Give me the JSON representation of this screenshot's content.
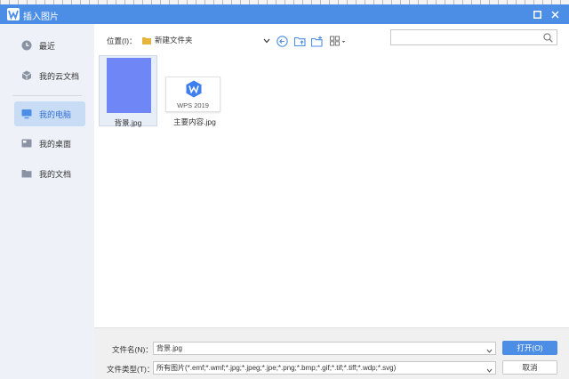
{
  "window": {
    "title": "插入图片"
  },
  "sidebar": {
    "items": [
      {
        "label": "最近"
      },
      {
        "label": "我的云文档"
      },
      {
        "label": "我的电脑"
      },
      {
        "label": "我的桌面"
      },
      {
        "label": "我的文档"
      }
    ],
    "active": "我的电脑"
  },
  "toolbar": {
    "location_label": "位置(I)：",
    "location_value": "新建文件夹"
  },
  "search": {
    "value": "",
    "placeholder": ""
  },
  "files": [
    {
      "name": "背景.jpg",
      "thumb_color": "#6f86f7"
    },
    {
      "name": "主要内容.jpg",
      "thumb_text": "WPS 2019"
    }
  ],
  "footer": {
    "filename_label": "文件名(N)：",
    "filename_value": "背景.jpg",
    "filetype_label": "文件类型(T)：",
    "filetype_value": "所有图片(*.emf;*.wmf;*.jpg;*.jpeg;*.jpe;*.png;*.bmp;*.gif;*.tif;*.tiff;*.wdp;*.svg)",
    "open_label": "打开(O)",
    "cancel_label": "取消"
  },
  "colors": {
    "accent": "#4c8ee6",
    "sidebar_bg": "#eef2f8",
    "active_bg": "#c9dcf5"
  }
}
